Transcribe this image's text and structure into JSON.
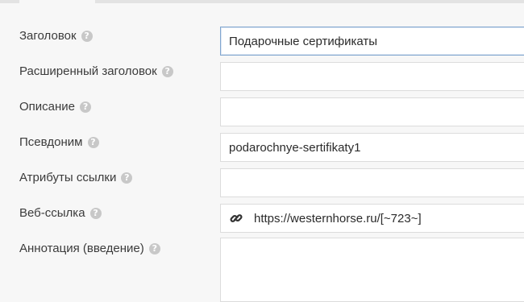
{
  "form": {
    "fields": [
      {
        "label": "Заголовок",
        "value": "Подарочные сертификаты"
      },
      {
        "label": "Расширенный заголовок",
        "value": ""
      },
      {
        "label": "Описание",
        "value": ""
      },
      {
        "label": "Псевдоним",
        "value": "podarochnye-sertifikaty1"
      },
      {
        "label": "Атрибуты ссылки",
        "value": ""
      },
      {
        "label": "Веб-ссылка",
        "value": "https://westernhorse.ru/[~723~]"
      },
      {
        "label": "Аннотация (введение)",
        "value": ""
      }
    ],
    "help_glyph": "?",
    "link_icon": "link-icon"
  },
  "colors": {
    "background": "#f7f7f7",
    "field_border": "#dcdcdc",
    "focus_border": "#7fa5cf",
    "help_icon": "#c8c8c8"
  }
}
